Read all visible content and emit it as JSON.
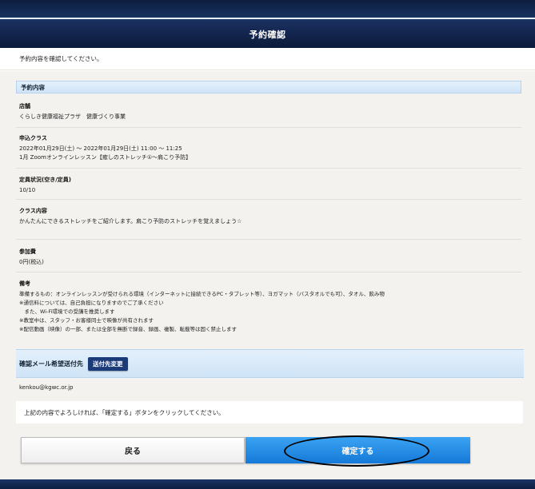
{
  "header": {
    "title": "予約確認"
  },
  "instruction": "予約内容を確認してください。",
  "reservation": {
    "section_title": "予約内容",
    "store": {
      "label": "店舗",
      "value": "くらしき健康福祉プラザ　健康づくり事業"
    },
    "class_applied": {
      "label": "申込クラス",
      "lines": [
        "2022年01月29日(土) ～ 2022年01月29日(土) 11:00 ～ 11:25",
        "1月 Zoomオンラインレッスン【癒しのストレッチ①～肩こり予防】"
      ]
    },
    "capacity": {
      "label": "定員状況(空き/定員)",
      "value": "10/10"
    },
    "class_content": {
      "label": "クラス内容",
      "value": "かんたんにできるストレッチをご紹介します。肩こり予防のストレッチを覚えましょう☆"
    },
    "fee": {
      "label": "参加費",
      "value": "0円(税込)"
    },
    "notes": {
      "label": "備考",
      "lines": [
        "準備するもの：オンラインレッスンが受けられる環境（インターネットに接続できるPC・タブレット等）、ヨガマット（バスタオルでも可）、タオル、飲み物",
        "※通信料については、自己負担になりますのでご了承ください",
        "　また、Wi-Fi環境での受講を推奨します",
        "※教室中は、スタッフ・お客様同士で映像が共有されます",
        "※配信動画（映像）の一部、または全部を無断で録音、録画、複製、転載等は固く禁止します"
      ]
    }
  },
  "mail": {
    "title": "確認メール希望送付先",
    "change_button": "送付先変更",
    "email": "kenkou@kgwc.or.jp"
  },
  "confirm_message": "上記の内容でよろしければ、「確定する」ボタンをクリックしてください。",
  "buttons": {
    "back": "戻る",
    "confirm": "確定する"
  },
  "colors": {
    "header_bg": "#0b1a3a",
    "section_header_bg": "#d6e8f8",
    "confirm_button": "#1e88e5",
    "change_button": "#1b3a78"
  }
}
